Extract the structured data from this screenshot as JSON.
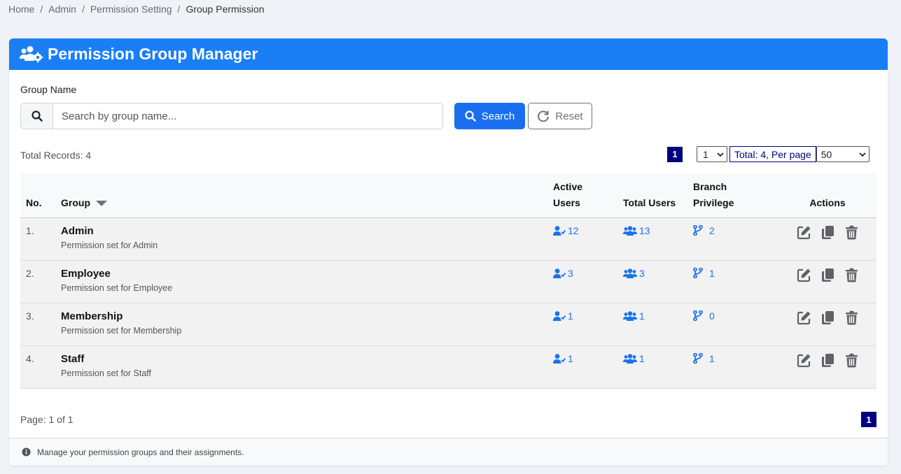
{
  "breadcrumb": {
    "items": [
      "Home",
      "Admin",
      "Permission Setting"
    ],
    "current": "Group Permission"
  },
  "header": {
    "title": "Permission Group Manager",
    "icon": "users-gear-icon"
  },
  "search": {
    "label": "Group Name",
    "placeholder": "Search by group name...",
    "value": "",
    "search_button": "Search",
    "reset_button": "Reset"
  },
  "records": {
    "total_text": "Total Records: 4",
    "current_page": "1",
    "page_select": "1",
    "per_page_label": "Total: 4, Per page",
    "per_page_value": "50"
  },
  "table": {
    "headers": {
      "no": "No.",
      "group": "Group",
      "active_line1": "Active",
      "active_line2": "Users",
      "total": "Total Users",
      "branch_line1": "Branch",
      "branch_line2": "Privilege",
      "actions": "Actions"
    },
    "rows": [
      {
        "no": "1.",
        "name": "Admin",
        "desc": "Permission set for Admin",
        "active": "12",
        "total": "13",
        "branch": "2"
      },
      {
        "no": "2.",
        "name": "Employee",
        "desc": "Permission set for Employee",
        "active": "3",
        "total": "3",
        "branch": "1"
      },
      {
        "no": "3.",
        "name": "Membership",
        "desc": "Permission set for Membership",
        "active": "1",
        "total": "1",
        "branch": "0"
      },
      {
        "no": "4.",
        "name": "Staff",
        "desc": "Permission set for Staff",
        "active": "1",
        "total": "1",
        "branch": "1"
      }
    ]
  },
  "footer": {
    "page_info": "Page: 1 of 1",
    "current_page": "1",
    "note": "Manage your permission groups and their assignments."
  },
  "colors": {
    "primary": "#1a7ef5",
    "link": "#1a73e8",
    "pager": "#000080"
  }
}
